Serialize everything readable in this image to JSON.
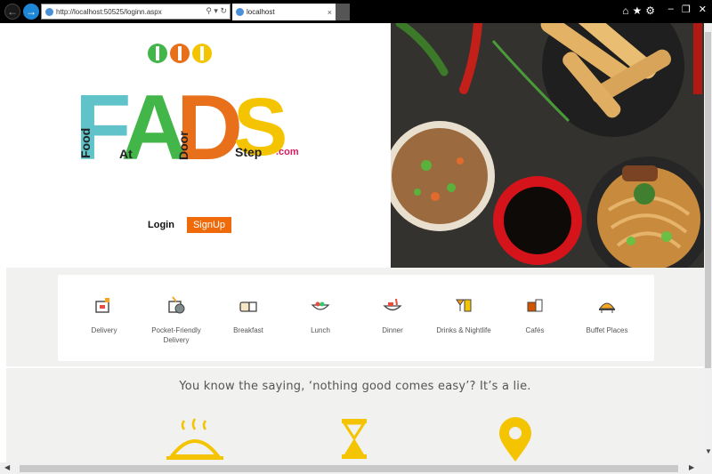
{
  "browser": {
    "url": "http://localhost:50525/loginn.aspx",
    "tab_title": "localhost",
    "tab_close": "×",
    "address_tools": "⚲ ▾ ↻"
  },
  "logo": {
    "letters": [
      "F",
      "A",
      "D",
      "S"
    ],
    "words": [
      "Food",
      "At",
      "Door",
      "Step"
    ],
    "suffix": ".com"
  },
  "auth": {
    "login_label": "Login",
    "signup_label": "SignUp"
  },
  "categories": [
    {
      "label": "Delivery",
      "icon": "delivery-icon"
    },
    {
      "label": "Pocket-Friendly Delivery",
      "icon": "pocket-friendly-icon"
    },
    {
      "label": "Breakfast",
      "icon": "breakfast-icon"
    },
    {
      "label": "Lunch",
      "icon": "lunch-icon"
    },
    {
      "label": "Dinner",
      "icon": "dinner-icon"
    },
    {
      "label": "Drinks & Nightlife",
      "icon": "drinks-icon"
    },
    {
      "label": "Cafés",
      "icon": "cafes-icon"
    },
    {
      "label": "Buffet Places",
      "icon": "buffet-icon"
    }
  ],
  "tagline": "You know the saying, ‘nothing good comes easy’? It’s a lie.",
  "colors": {
    "accent": "#ee6a0a",
    "yellow": "#f5c400",
    "teal": "#5fc3c9",
    "green": "#43b649",
    "orange": "#e8701a"
  }
}
